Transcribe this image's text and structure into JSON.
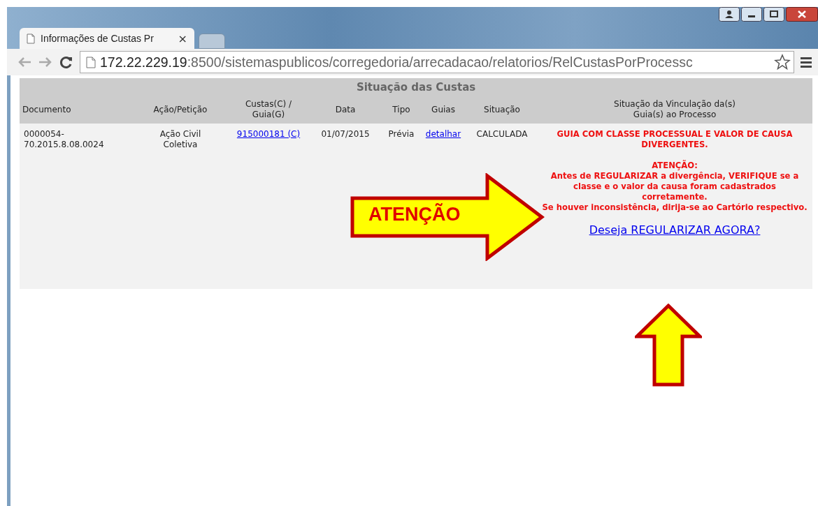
{
  "browser": {
    "tabs": [
      {
        "title": "Informações de Custas Pr",
        "close": "×",
        "selected": true
      },
      {
        "selected": false
      }
    ],
    "address": {
      "host": "172.22.229.19",
      "path": ":8500/sistemaspublicos/corregedoria/arrecadacao/relatorios/RelCustasPorProcessc"
    }
  },
  "report": {
    "title": "Situação das Custas",
    "columns": [
      "Documento",
      "Ação/Petição",
      "Custas(C) / Guia(G)",
      "Data",
      "Tipo",
      "Guias",
      "Situação",
      "Situação da Vinculação da(s) Guia(s) ao Processo"
    ],
    "rows": [
      {
        "documento": "0000054-70.2015.8.08.0024",
        "acao": "Ação Civil Coletiva",
        "custas": "915000181 (C)",
        "data": "01/07/2015",
        "tipo": "Prévia",
        "guias": "detalhar",
        "situacao": "CALCULADA",
        "vinculacao": {
          "status": "GUIA COM CLASSE PROCESSUAL E VALOR DE CAUSA DIVERGENTES.",
          "warning_title": "ATENÇÃO:",
          "warning_lines": [
            "Antes de REGULARIZAR a divergência, VERIFIQUE se a classe e o valor da causa foram cadastrados corretamente.",
            "Se houver inconsistência, dirija-se ao Cartório respectivo."
          ],
          "action": "Deseja REGULARIZAR AGORA?"
        }
      }
    ]
  },
  "annotations": [
    {
      "kind": "right",
      "label": "ATENÇÃO"
    },
    {
      "kind": "up"
    }
  ]
}
